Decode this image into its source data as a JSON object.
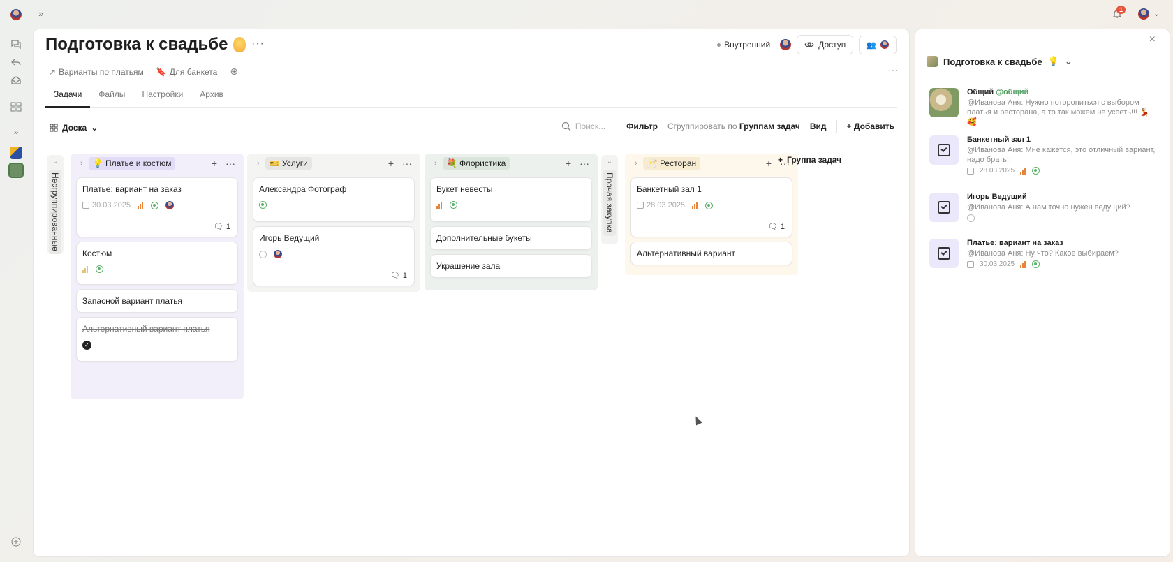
{
  "header": {
    "title": "Подготовка к свадьбе",
    "visibility": "Внутренний",
    "access_label": "Доступ",
    "notifications_count": "1",
    "links": [
      {
        "label": "Варианты по платьям"
      },
      {
        "label": "Для банкета"
      }
    ]
  },
  "tabs": [
    "Задачи",
    "Файлы",
    "Настройки",
    "Архив"
  ],
  "toolbar": {
    "view": "Доска",
    "search_placeholder": "Поиск...",
    "filter": "Фильтр",
    "group_by_label": "Сгруппировать по",
    "group_by_value": "Группам задач",
    "view_label": "Вид",
    "add_label": "Добавить"
  },
  "board": {
    "ungrouped_label": "Несгруппированные",
    "urgent_label": "Прочая закупка",
    "add_group": "Группа задач",
    "columns": [
      {
        "name": "Платье и костюм",
        "cards": [
          {
            "title": "Платье: вариант на заказ",
            "date": "30.03.2025",
            "comments": "1"
          },
          {
            "title": "Костюм"
          },
          {
            "title": "Запасной вариант платья"
          },
          {
            "title": "Альтернативный вариант платья"
          }
        ]
      },
      {
        "name": "Услуги",
        "cards": [
          {
            "title": "Александра Фотограф"
          },
          {
            "title": "Игорь Ведущий",
            "comments": "1"
          }
        ]
      },
      {
        "name": "Флористика",
        "cards": [
          {
            "title": "Букет невесты"
          },
          {
            "title": "Дополнительные букеты"
          },
          {
            "title": "Украшение зала"
          }
        ]
      },
      {
        "name": "Ресторан",
        "cards": [
          {
            "title": "Банкетный зал 1",
            "date": "28.03.2025",
            "comments": "1"
          },
          {
            "title": "Альтернативный вариант"
          }
        ]
      }
    ]
  },
  "side_panel": {
    "title": "Подготовка к свадьбе",
    "chats": [
      {
        "name": "Общий",
        "mention": "@общий",
        "message": "@Иванова Аня: Нужно поторопиться с выбором платья и ресторана, а то так можем не успеть!!! 💃 🥰"
      },
      {
        "name": "Банкетный зал 1",
        "message": "@Иванова Аня: Мне кажется, это отличный вариант, надо брать!!!",
        "date": "28.03.2025"
      },
      {
        "name": "Игорь Ведущий",
        "message": "@Иванова Аня: А нам точно нужен ведущий?"
      },
      {
        "name": "Платье: вариант на заказ",
        "message": "@Иванова Аня: Ну что? Какое выбираем?",
        "date": "30.03.2025"
      }
    ]
  }
}
